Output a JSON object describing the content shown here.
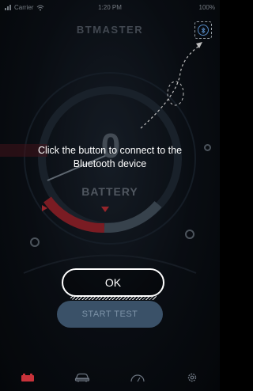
{
  "status_bar": {
    "carrier": "Carrier",
    "time": "1:20 PM",
    "battery": "100%"
  },
  "header": {
    "app_title": "BTMASTER",
    "bluetooth_icon": "bluetooth-connect-icon"
  },
  "gauge": {
    "value": "0",
    "label": "BATTERY",
    "accent_color": "#c8323a"
  },
  "tutorial": {
    "message": "Click the button to connect to the Bluetooth device",
    "ok_label": "OK"
  },
  "start_button": {
    "label": "START TEST"
  },
  "tabbar": {
    "items": [
      {
        "icon": "battery-icon",
        "active": true
      },
      {
        "icon": "car-icon",
        "active": false
      },
      {
        "icon": "speedometer-icon",
        "active": false
      },
      {
        "icon": "gear-icon",
        "active": false
      }
    ],
    "active_color": "#c8323a",
    "inactive_color": "#6c7580"
  }
}
